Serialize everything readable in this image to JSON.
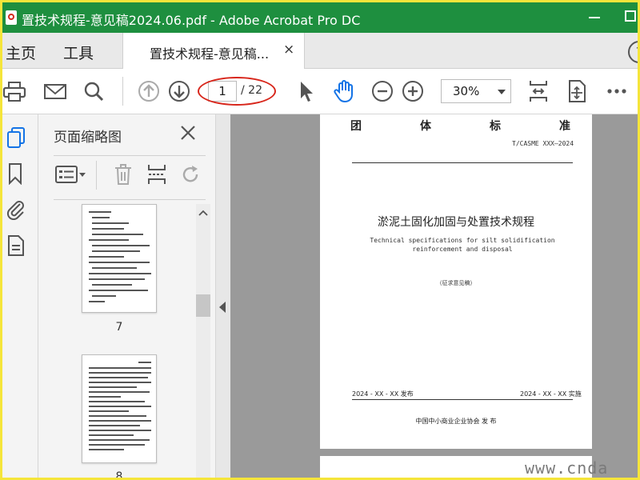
{
  "window": {
    "title": "置技术规程-意见稿2024.06.pdf - Adobe Acrobat Pro DC"
  },
  "tabs": {
    "home": "主页",
    "tools": "工具",
    "document": "置技术规程-意见稿...",
    "close": "×",
    "help": "?"
  },
  "toolbar": {
    "current_page": "1",
    "page_total": "/ 22",
    "zoom": "30%"
  },
  "panel": {
    "title": "页面缩略图",
    "thumbnails": [
      {
        "label": "7"
      },
      {
        "label": "8"
      }
    ]
  },
  "page": {
    "org_chars": [
      "团",
      "体",
      "标",
      "准"
    ],
    "code": "T/CASME XXX—2024",
    "title": "淤泥土固化加固与处置技术规程",
    "subtitle": "Technical specifications for silt solidification reinforcement and disposal",
    "draft": "（征求意见稿）",
    "publish_date": "2024 - XX - XX 发布",
    "implement_date": "2024 - XX - XX 实施",
    "issuer": "中国中小商业企业协会  发  布"
  },
  "watermark": "www.cnda",
  "colors": {
    "title_bar": "#1e8f3f",
    "accent_blue": "#1473e6",
    "annotation_red": "#d8261b"
  },
  "icons": [
    "print-icon",
    "email-icon",
    "search-icon",
    "page-up-icon",
    "page-down-icon",
    "select-arrow-icon",
    "hand-icon",
    "zoom-out-icon",
    "zoom-in-icon",
    "fit-page-icon",
    "scroll-mode-icon",
    "more-icon"
  ]
}
